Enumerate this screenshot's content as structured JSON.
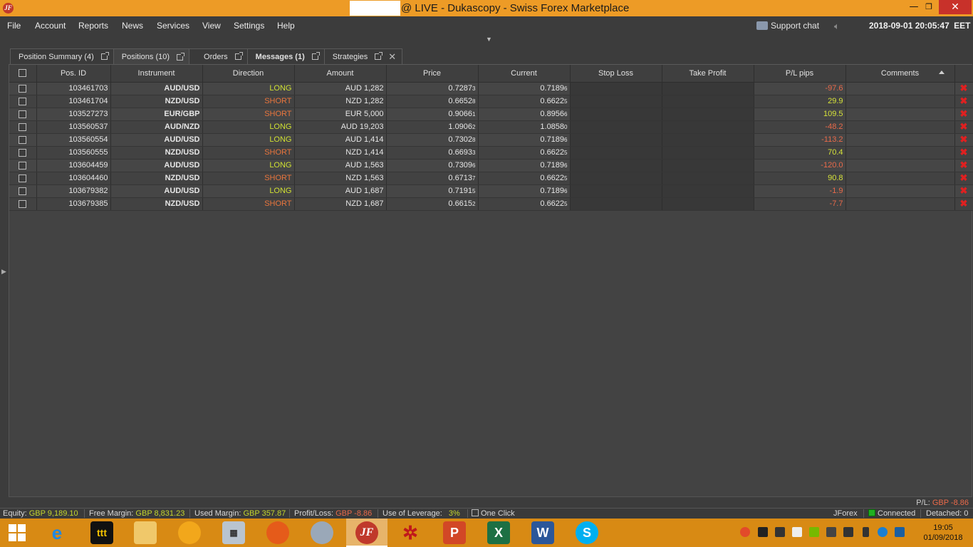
{
  "window": {
    "title": "@ LIVE - Dukascopy - Swiss Forex Marketplace",
    "minimize": "—",
    "maximize": "❐",
    "close": "✕"
  },
  "menu": [
    "File",
    "Account",
    "Reports",
    "News",
    "Services",
    "View",
    "Settings",
    "Help"
  ],
  "header": {
    "support_chat": "Support chat",
    "datetime": "2018-09-01 20:05:47",
    "timezone": "EET"
  },
  "tabs": [
    {
      "label": "Position Summary (4)"
    },
    {
      "label": "Positions (10)"
    },
    {
      "label": "Orders"
    },
    {
      "label": "Messages (1)"
    },
    {
      "label": "Strategies"
    }
  ],
  "columns": [
    "Pos. ID",
    "Instrument",
    "Direction",
    "Amount",
    "Price",
    "Current",
    "Stop Loss",
    "Take Profit",
    "P/L pips",
    "Comments"
  ],
  "positions": [
    {
      "id": "103461703",
      "instrument": "AUD/USD",
      "direction": "LONG",
      "amount": "AUD 1,282",
      "price": "0.7287",
      "price_sub": "3",
      "current": "0.7189",
      "current_sub": "6",
      "stop_loss": "",
      "take_profit": "",
      "pl": "-97.6",
      "comment": ""
    },
    {
      "id": "103461704",
      "instrument": "NZD/USD",
      "direction": "SHORT",
      "amount": "NZD 1,282",
      "price": "0.6652",
      "price_sub": "8",
      "current": "0.6622",
      "current_sub": "5",
      "stop_loss": "",
      "take_profit": "",
      "pl": "29.9",
      "comment": ""
    },
    {
      "id": "103527273",
      "instrument": "EUR/GBP",
      "direction": "SHORT",
      "amount": "EUR 5,000",
      "price": "0.9066",
      "price_sub": "1",
      "current": "0.8956",
      "current_sub": "6",
      "stop_loss": "",
      "take_profit": "",
      "pl": "109.5",
      "comment": ""
    },
    {
      "id": "103560537",
      "instrument": "AUD/NZD",
      "direction": "LONG",
      "amount": "AUD 19,203",
      "price": "1.0906",
      "price_sub": "2",
      "current": "1.0858",
      "current_sub": "0",
      "stop_loss": "",
      "take_profit": "",
      "pl": "-48.2",
      "comment": ""
    },
    {
      "id": "103560554",
      "instrument": "AUD/USD",
      "direction": "LONG",
      "amount": "AUD 1,414",
      "price": "0.7302",
      "price_sub": "8",
      "current": "0.7189",
      "current_sub": "6",
      "stop_loss": "",
      "take_profit": "",
      "pl": "-113.2",
      "comment": ""
    },
    {
      "id": "103560555",
      "instrument": "NZD/USD",
      "direction": "SHORT",
      "amount": "NZD 1,414",
      "price": "0.6693",
      "price_sub": "3",
      "current": "0.6622",
      "current_sub": "5",
      "stop_loss": "",
      "take_profit": "",
      "pl": "70.4",
      "comment": ""
    },
    {
      "id": "103604459",
      "instrument": "AUD/USD",
      "direction": "LONG",
      "amount": "AUD 1,563",
      "price": "0.7309",
      "price_sub": "6",
      "current": "0.7189",
      "current_sub": "6",
      "stop_loss": "",
      "take_profit": "",
      "pl": "-120.0",
      "comment": ""
    },
    {
      "id": "103604460",
      "instrument": "NZD/USD",
      "direction": "SHORT",
      "amount": "NZD 1,563",
      "price": "0.6713",
      "price_sub": "7",
      "current": "0.6622",
      "current_sub": "5",
      "stop_loss": "",
      "take_profit": "",
      "pl": "90.8",
      "comment": ""
    },
    {
      "id": "103679382",
      "instrument": "AUD/USD",
      "direction": "LONG",
      "amount": "AUD 1,687",
      "price": "0.7191",
      "price_sub": "5",
      "current": "0.7189",
      "current_sub": "6",
      "stop_loss": "",
      "take_profit": "",
      "pl": "-1.9",
      "comment": ""
    },
    {
      "id": "103679385",
      "instrument": "NZD/USD",
      "direction": "SHORT",
      "amount": "NZD 1,687",
      "price": "0.6615",
      "price_sub": "2",
      "current": "0.6622",
      "current_sub": "5",
      "stop_loss": "",
      "take_profit": "",
      "pl": "-7.7",
      "comment": ""
    }
  ],
  "summary": {
    "pl_label": "P/L:",
    "pl_value": "GBP -8.86"
  },
  "status": {
    "equity_label": "Equity:",
    "equity": "GBP 9,189.10",
    "free_margin_label": "Free Margin:",
    "free_margin": "GBP 8,831.23",
    "used_margin_label": "Used Margin:",
    "used_margin": "GBP 357.87",
    "profit_loss_label": "Profit/Loss:",
    "profit_loss": "GBP -8.86",
    "leverage_label": "Use of Leverage:",
    "leverage": "3%",
    "one_click": "One Click",
    "platform": "JForex",
    "connection": "Connected",
    "detached": "Detached: 0"
  },
  "taskbar": {
    "time": "19:05",
    "date": "01/09/2018"
  },
  "colors": {
    "title_bar": "#ed9b26",
    "long": "#cfe032",
    "short": "#e9753d",
    "profit": "#d6e23a",
    "loss": "#ea6a4a",
    "taskbar": "#d88a14"
  }
}
